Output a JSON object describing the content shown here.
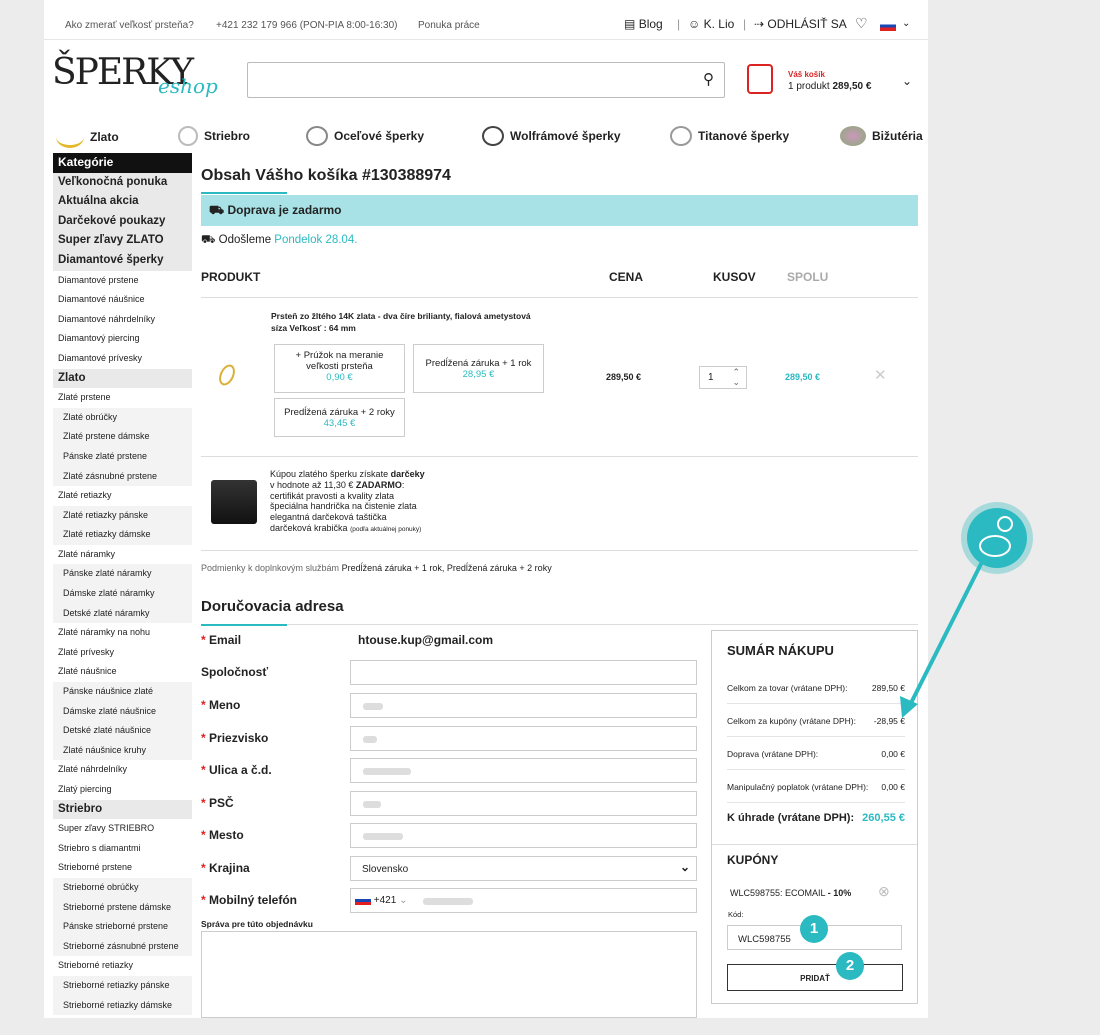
{
  "topbar": {
    "ring_size": "Ako zmerať veľkosť prsteňa?",
    "phone": "+421 232 179 966 (PON-PIA 8:00-16:30)",
    "jobs": "Ponuka práce",
    "blog": "Blog",
    "user": "K. Lio",
    "logout": "ODHLÁSIŤ SA"
  },
  "logo": {
    "main": "ŠPERKY",
    "sub": "eshop"
  },
  "cart": {
    "label": "Váš košík",
    "count": "1 produkt",
    "total": "289,50 €"
  },
  "categories": [
    "Zlato",
    "Striebro",
    "Oceľové šperky",
    "Wolfrámové šperky",
    "Titanové šperky",
    "Bižutéria"
  ],
  "sidebar": [
    {
      "t": "Kategórie",
      "c": "hh"
    },
    {
      "t": "Veľkonočná ponuka",
      "c": "h"
    },
    {
      "t": "Aktuálna akcia",
      "c": "h"
    },
    {
      "t": "Darčekové poukazy",
      "c": "h"
    },
    {
      "t": "Super zľavy ZLATO",
      "c": "h"
    },
    {
      "t": "Diamantové šperky",
      "c": "h"
    },
    {
      "t": "Diamantové prstene",
      "c": "s"
    },
    {
      "t": "Diamantové náušnice",
      "c": "s"
    },
    {
      "t": "Diamantové náhrdelníky",
      "c": "s"
    },
    {
      "t": "Diamantový piercing",
      "c": "s"
    },
    {
      "t": "Diamantové prívesky",
      "c": "s"
    },
    {
      "t": "Zlato",
      "c": "h"
    },
    {
      "t": "Zlaté prstene",
      "c": "s"
    },
    {
      "t": "Zlaté obrúčky",
      "c": "ss"
    },
    {
      "t": "Zlaté prstene dámske",
      "c": "ss"
    },
    {
      "t": "Pánske zlaté prstene",
      "c": "ss"
    },
    {
      "t": "Zlaté zásnubné prstene",
      "c": "ss"
    },
    {
      "t": "Zlaté retiazky",
      "c": "s"
    },
    {
      "t": "Zlaté retiazky pánske",
      "c": "ss"
    },
    {
      "t": "Zlaté retiazky dámske",
      "c": "ss"
    },
    {
      "t": "Zlaté náramky",
      "c": "s"
    },
    {
      "t": "Pánske zlaté náramky",
      "c": "ss"
    },
    {
      "t": "Dámske zlaté náramky",
      "c": "ss"
    },
    {
      "t": "Detské zlaté náramky",
      "c": "ss"
    },
    {
      "t": "Zlaté náramky na nohu",
      "c": "s"
    },
    {
      "t": "Zlaté prívesky",
      "c": "s"
    },
    {
      "t": "Zlaté náušnice",
      "c": "s"
    },
    {
      "t": "Pánske náušnice zlaté",
      "c": "ss"
    },
    {
      "t": "Dámske zlaté náušnice",
      "c": "ss"
    },
    {
      "t": "Detské zlaté náušnice",
      "c": "ss"
    },
    {
      "t": "Zlaté náušnice kruhy",
      "c": "ss"
    },
    {
      "t": "Zlaté náhrdelníky",
      "c": "s"
    },
    {
      "t": "Zlatý piercing",
      "c": "s"
    },
    {
      "t": "Striebro",
      "c": "h"
    },
    {
      "t": "Super zľavy STRIEBRO",
      "c": "s"
    },
    {
      "t": "Striebro s diamantmi",
      "c": "s"
    },
    {
      "t": "Strieborné prstene",
      "c": "s"
    },
    {
      "t": "Strieborné obrúčky",
      "c": "ss"
    },
    {
      "t": "Strieborné prstene dámske",
      "c": "ss"
    },
    {
      "t": "Pánske strieborné prstene",
      "c": "ss"
    },
    {
      "t": "Strieborné zásnubné prstene",
      "c": "ss"
    },
    {
      "t": "Strieborné retiazky",
      "c": "s"
    },
    {
      "t": "Strieborné retiazky pánske",
      "c": "ss"
    },
    {
      "t": "Strieborné retiazky dámske",
      "c": "ss"
    }
  ],
  "main": {
    "title": "Obsah Vášho košíka",
    "order": "#130388974",
    "free_shipping": "Doprava je zadarmo",
    "ship_label": "Odošleme",
    "ship_date": "Pondelok 28.04.",
    "cols": {
      "product": "PRODUKT",
      "price": "CENA",
      "qty": "KUSOV",
      "total": "SPOLU"
    },
    "item": {
      "name": "Prsteň zo žltého 14K zlata - dva číre brilianty, fialová ametystová",
      "size": "síza Veľkosť : 64 mm",
      "price": "289,50 €",
      "qty": "1",
      "total": "289,50 €",
      "addons": [
        {
          "label": "+ Prúžok na meranie veľkosti prsteňa",
          "price": "0,90 €"
        },
        {
          "label": "Predĺžená záruka + 1 rok",
          "price": "28,95 €"
        },
        {
          "label": "Predĺžená záruka + 2 roky",
          "price": "43,45 €"
        }
      ]
    },
    "gift": {
      "l1a": "Kúpou zlatého šperku získate ",
      "l1b": "darčeky",
      "l2a": "v hodnote až 11,30 € ",
      "l2b": "ZADARMO",
      "l2c": ":",
      "l3": "certifikát pravosti a kvality zlata",
      "l4": "špeciálna handrička na čistenie zlata",
      "l5": "elegantná darčeková taštička",
      "l6": "darčeková krabička",
      "l6s": "(podľa aktuálnej ponuky)"
    },
    "terms_label": "Podmienky k doplnkovým službám",
    "terms_links": "Predĺžená záruka + 1 rok, Predĺžená záruka + 2 roky"
  },
  "address": {
    "title": "Doručovacia adresa",
    "email_label": "Email",
    "email": "htouse.kup@gmail.com",
    "company": "Spoločnosť",
    "name": "Meno",
    "surname": "Priezvisko",
    "street": "Ulica a č.d.",
    "zip": "PSČ",
    "city": "Mesto",
    "country_label": "Krajina",
    "country": "Slovensko",
    "phone_label": "Mobilný telefón",
    "prefix": "+421",
    "message": "Správa pre túto objednávku"
  },
  "summary": {
    "title": "SUMÁR NÁKUPU",
    "rows": [
      {
        "l": "Celkom za tovar (vrátane DPH):",
        "v": "289,50 €"
      },
      {
        "l": "Celkom za kupóny (vrátane DPH):",
        "v": "-28,95 €"
      },
      {
        "l": "Doprava (vrátane DPH):",
        "v": "0,00 €"
      },
      {
        "l": "Manipulačný poplatok (vrátane DPH):",
        "v": "0,00 €"
      }
    ],
    "total_label": "K úhrade (vrátane DPH):",
    "total": "260,55 €",
    "coupons": "KUPÓNY",
    "coupon_name": "WLC598755: ECOMAIL",
    "coupon_disc": "- 10%",
    "code_label": "Kód:",
    "code": "WLC598755",
    "add": "PRIDAŤ"
  },
  "badges": [
    "1",
    "2"
  ],
  "accent": "#2bbac1"
}
